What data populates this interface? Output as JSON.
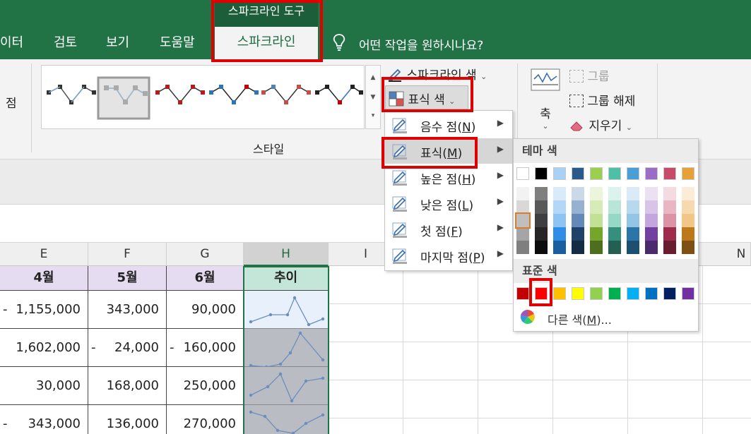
{
  "tabs": {
    "context_group": "스파크라인 도구",
    "data": "이터",
    "review": "검토",
    "view": "보기",
    "help": "도움말",
    "sparkline": "스파크라인",
    "tell_me": "어떤 작업을 원하시나요?"
  },
  "ribbon": {
    "left_partial": "점",
    "style_group": "스타일",
    "sparkline_color": "스파크라인 색",
    "marker_color": "표식 색",
    "axis": "축",
    "group": "그룹",
    "ungroup": "그룹 해제",
    "clear": "지우기"
  },
  "marker_menu": {
    "items": [
      {
        "label": "음수 점(",
        "key": "N",
        "tail": ")"
      },
      {
        "label": "표식(",
        "key": "M",
        "tail": ")"
      },
      {
        "label": "높은 점(",
        "key": "H",
        "tail": ")"
      },
      {
        "label": "낮은 점(",
        "key": "L",
        "tail": ")"
      },
      {
        "label": "첫 점(",
        "key": "F",
        "tail": ")"
      },
      {
        "label": "마지막 점(",
        "key": "P",
        "tail": ")"
      }
    ]
  },
  "palette": {
    "theme_header": "테마 색",
    "standard_header": "표준 색",
    "more_colors": "다른 색(",
    "more_colors_key": "M",
    "more_colors_tail": ")...",
    "theme_top": [
      "#ffffff",
      "#000000",
      "#a9d0f5",
      "#2b5a8a",
      "#9bcf4f",
      "#4fbfa7",
      "#4a9fd4",
      "#9b6dc6",
      "#c84a6a",
      "#e8a03a"
    ],
    "theme_shades": [
      [
        "#f2f2f2",
        "#7f7f7f",
        "#d9ebfb",
        "#cbd8e8",
        "#ebf5dc",
        "#dcf2ec",
        "#dbebf6",
        "#ebe1f3",
        "#f3dbe1",
        "#fbecd7"
      ],
      [
        "#d8d8d8",
        "#595959",
        "#b4d7f7",
        "#97b1d1",
        "#d7ebb9",
        "#b9e5d9",
        "#b7d8ed",
        "#d7c4e8",
        "#e8b7c3",
        "#f6d9af"
      ],
      [
        "#bfbfbf",
        "#3f3f3f",
        "#8ec4f3",
        "#6389b9",
        "#c3e196",
        "#96d8c6",
        "#93c5e4",
        "#c3a7dc",
        "#dc93a5",
        "#f2c687"
      ],
      [
        "#a5a5a5",
        "#262626",
        "#2f8de8",
        "#1f4368",
        "#73a62b",
        "#348f7c",
        "#2a76a8",
        "#7140a0",
        "#9e2c4a",
        "#bd781a"
      ],
      [
        "#7f7f7f",
        "#0c0c0c",
        "#195e9f",
        "#142d45",
        "#4d6f1d",
        "#235f53",
        "#1c4f70",
        "#4b2b6b",
        "#691d31",
        "#7e5011"
      ]
    ],
    "standard": [
      "#c00000",
      "#ff0000",
      "#ffc000",
      "#ffff00",
      "#92d050",
      "#00b050",
      "#00b0f0",
      "#0070c0",
      "#002060",
      "#7030a0"
    ]
  },
  "grid": {
    "columns": [
      "E",
      "F",
      "G",
      "H",
      "I",
      "N"
    ],
    "headers": [
      "4월",
      "5월",
      "6월",
      "추이"
    ],
    "rows": [
      {
        "e": "1,155,000",
        "e_neg": true,
        "f": "343,000",
        "f_neg": false,
        "g": "90,000",
        "g_neg": false
      },
      {
        "e": "1,602,000",
        "e_neg": false,
        "f": "24,000",
        "f_neg": true,
        "g": "160,000",
        "g_neg": true
      },
      {
        "e": "30,000",
        "e_neg": false,
        "f": "168,000",
        "f_neg": false,
        "g": "250,000",
        "g_neg": false
      },
      {
        "e": "343,000",
        "e_neg": true,
        "f": "136,000",
        "f_neg": false,
        "g": "270,000",
        "g_neg": false
      }
    ],
    "dash": "-"
  },
  "colors": {
    "excel_green": "#217346",
    "highlight_red": "#e00000",
    "sparkline_blue": "#6a8fbf"
  }
}
